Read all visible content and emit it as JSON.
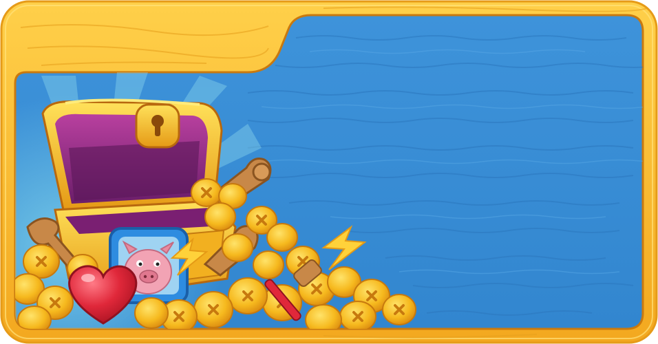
{
  "panel": {
    "frame_color": "#F7B52A",
    "frame_highlight": "#FFD45A",
    "frame_shadow": "#D98A12",
    "water_color": "#3B8FD6",
    "water_dark": "#2F7CC4",
    "water_light": "#56A6E4"
  },
  "scene": {
    "chest_icon": "treasure-chest-icon",
    "portrait_icon": "pig-portrait-icon",
    "heart_icon": "heart-icon",
    "key_icon": "key-icon",
    "bolt_icon": "lightning-bolt-icon",
    "hammer_icon": "hammer-icon",
    "coin_icon": "gold-coin-icon",
    "coin_color": "#F6B91E",
    "heart_color": "#E0283A",
    "chest_lid_color": "#9B2E8E",
    "portrait_frame_color": "#2E8CE0"
  }
}
